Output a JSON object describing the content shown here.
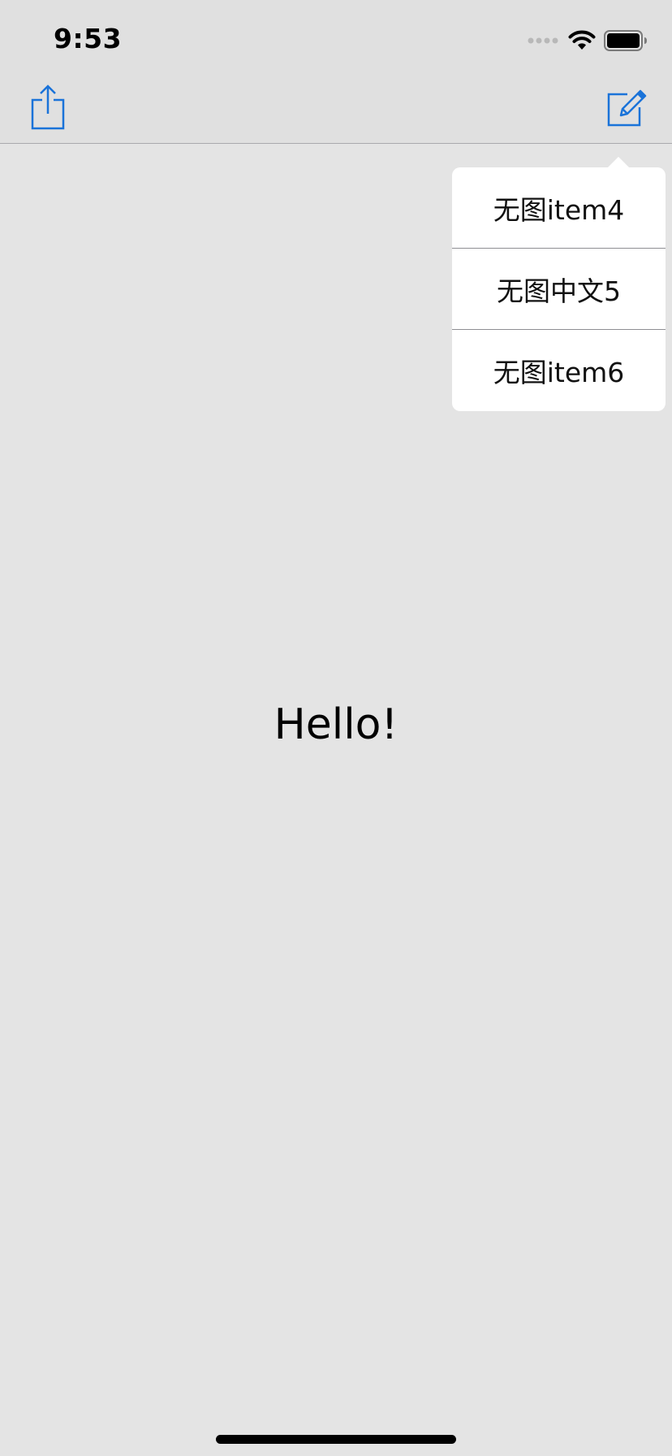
{
  "status_bar": {
    "time": "9:53",
    "icons": [
      "signal-icon",
      "wifi-icon",
      "battery-icon"
    ]
  },
  "nav_bar": {
    "left_button_icon": "share-icon",
    "right_button_icon": "compose-icon"
  },
  "main": {
    "greeting": "Hello!"
  },
  "popover_menu": {
    "items": [
      {
        "label": "无图item4"
      },
      {
        "label": "无图中文5"
      },
      {
        "label": "无图item6"
      }
    ]
  },
  "colors": {
    "accent": "#1a73d9",
    "background": "#e4e4e4",
    "nav_background": "#e0e0e0",
    "popover_background": "#ffffff"
  }
}
